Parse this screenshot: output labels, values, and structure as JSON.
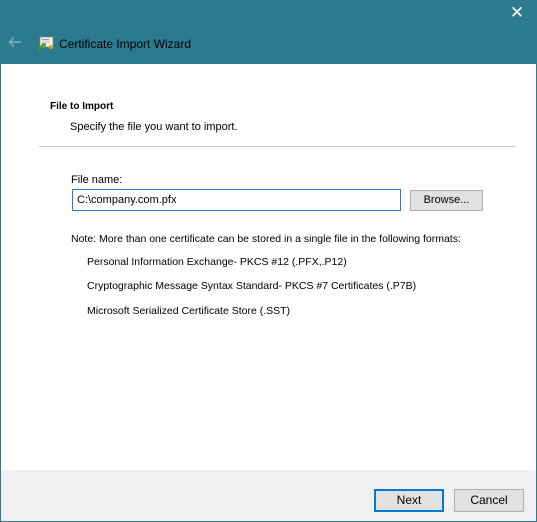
{
  "window": {
    "title": "Certificate Import Wizard",
    "close_label": "✕",
    "titlebar_color": "#2b7a8e"
  },
  "icons": {
    "back": "back-arrow-icon",
    "certificate": "certificate-icon",
    "close": "close-icon"
  },
  "page": {
    "heading": "File to Import",
    "subheading": "Specify the file you want to import."
  },
  "file": {
    "label": "File name:",
    "value": "C:\\company.com.pfx",
    "browse_label": "Browse..."
  },
  "note": "Note:  More than one certificate can be stored in a single file in the following formats:",
  "formats": [
    "Personal Information Exchange- PKCS #12 (.PFX,.P12)",
    "Cryptographic Message Syntax Standard- PKCS #7 Certificates (.P7B)",
    "Microsoft Serialized Certificate Store (.SST)"
  ],
  "footer": {
    "next_label": "Next",
    "cancel_label": "Cancel"
  }
}
